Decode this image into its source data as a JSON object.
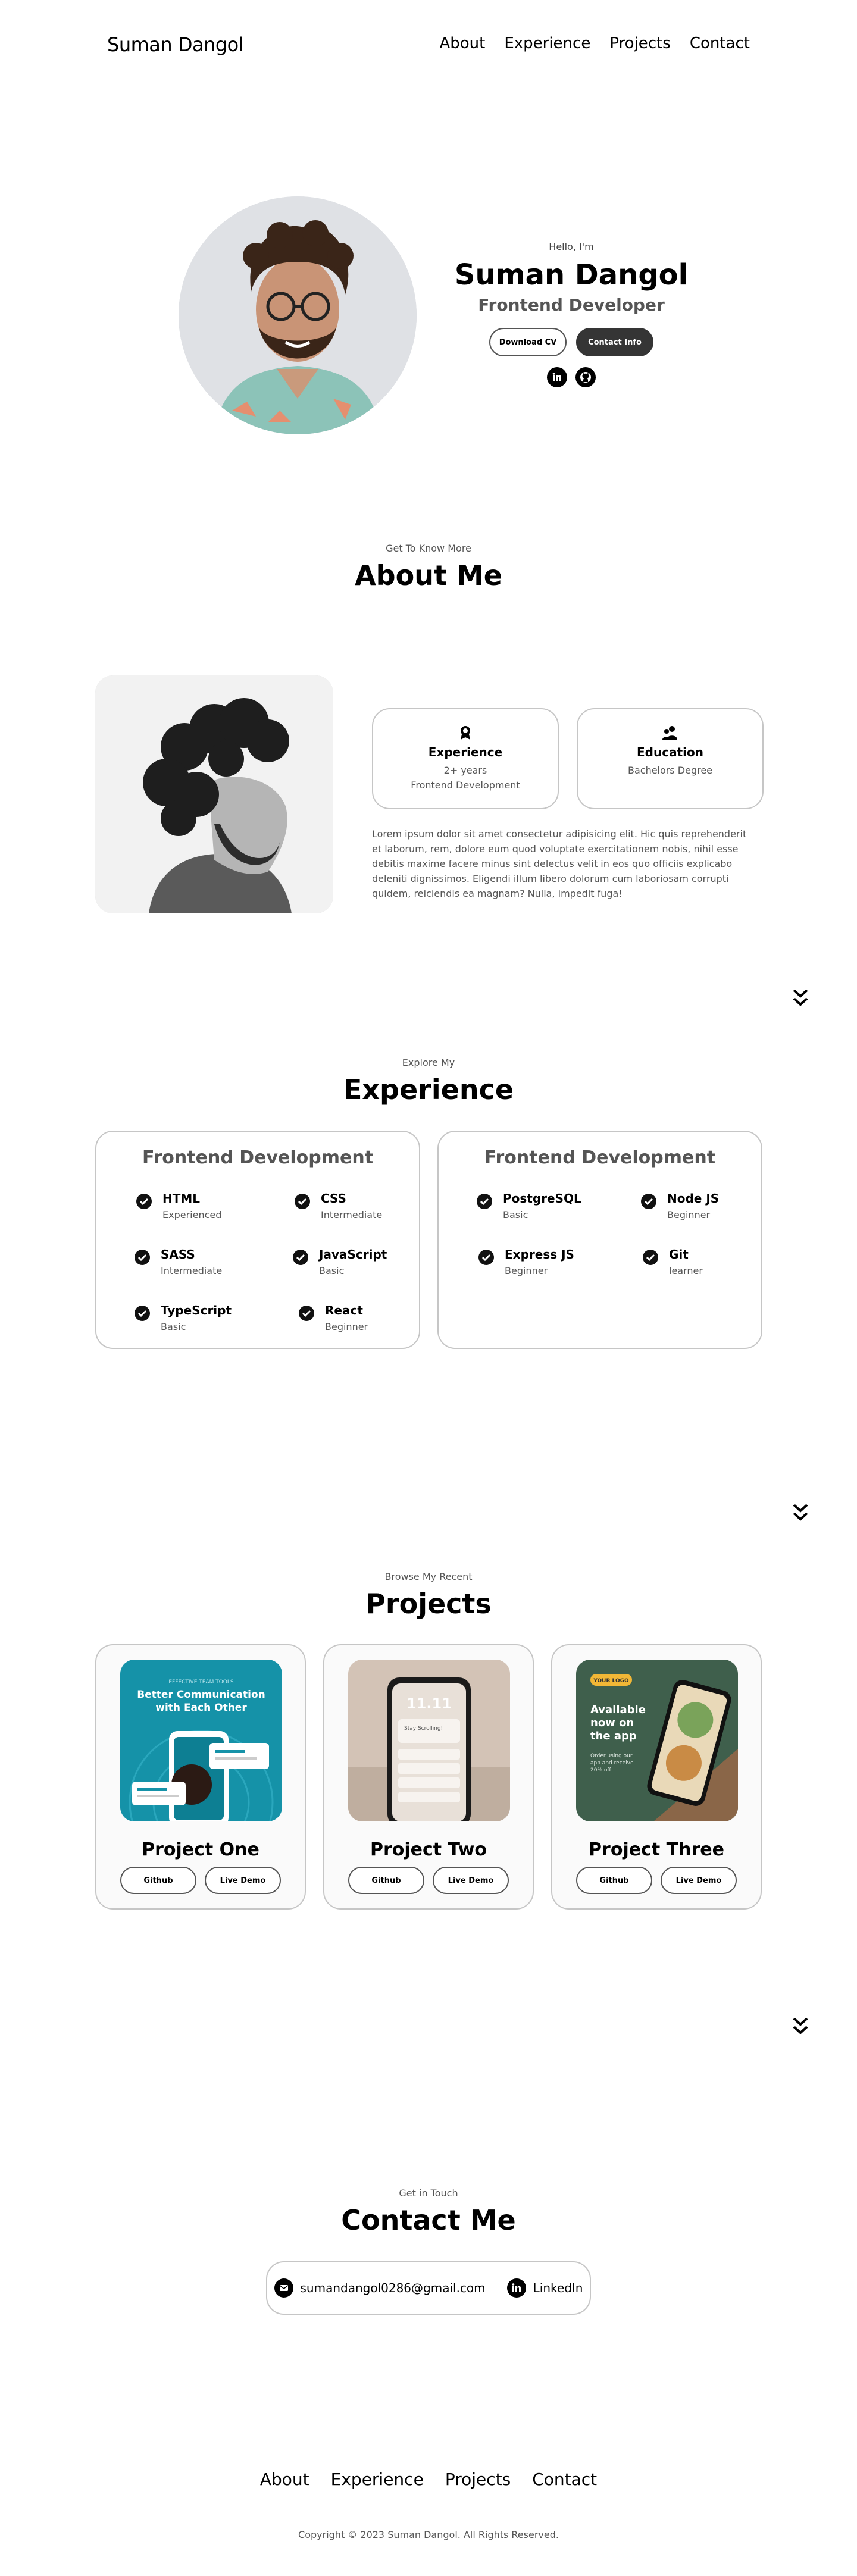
{
  "nav": {
    "logo": "Suman Dangol",
    "links": [
      "About",
      "Experience",
      "Projects",
      "Contact"
    ]
  },
  "hero": {
    "greeting": "Hello, I'm",
    "name": "Suman Dangol",
    "role": "Frontend Developer",
    "download_cv": "Download CV",
    "contact_info": "Contact Info",
    "socials": [
      "linkedin-icon",
      "github-icon"
    ]
  },
  "about": {
    "subtitle": "Get To Know More",
    "title": "About Me",
    "cards": [
      {
        "icon": "medal-icon",
        "title": "Experience",
        "lines": [
          "2+ years",
          "Frontend Development"
        ]
      },
      {
        "icon": "graduation-icon",
        "title": "Education",
        "lines": [
          "Bachelors Degree"
        ]
      }
    ],
    "paragraph": "Lorem ipsum dolor sit amet consectetur adipisicing elit. Hic quis reprehenderit et laborum, rem, dolore eum quod voluptate exercitationem nobis, nihil esse debitis maxime facere minus sint delectus velit in eos quo officiis explicabo deleniti dignissimos. Eligendi illum libero dolorum cum laboriosam corrupti quidem, reiciendis ea magnam? Nulla, impedit fuga!"
  },
  "experience": {
    "subtitle": "Explore My",
    "title": "Experience",
    "cards": [
      {
        "title": "Frontend Development",
        "skills": [
          {
            "name": "HTML",
            "level": "Experienced"
          },
          {
            "name": "CSS",
            "level": "Intermediate"
          },
          {
            "name": "SASS",
            "level": "Intermediate"
          },
          {
            "name": "JavaScript",
            "level": "Basic"
          },
          {
            "name": "TypeScript",
            "level": "Basic"
          },
          {
            "name": "React",
            "level": "Beginner"
          }
        ]
      },
      {
        "title": "Frontend Development",
        "skills": [
          {
            "name": "PostgreSQL",
            "level": "Basic"
          },
          {
            "name": "Node JS",
            "level": "Beginner"
          },
          {
            "name": "Express JS",
            "level": "Beginner"
          },
          {
            "name": "Git",
            "level": "learner"
          }
        ]
      }
    ]
  },
  "projects": {
    "subtitle": "Browse My Recent",
    "title": "Projects",
    "items": [
      {
        "title": "Project One",
        "github": "Github",
        "demo": "Live Demo",
        "img_text": [
          "EFFECTIVE TEAM TOOLS",
          "Better Communication",
          "with Each Other"
        ]
      },
      {
        "title": "Project Two",
        "github": "Github",
        "demo": "Live Demo",
        "img_text": [
          "11.11",
          "Stay Scrolling!"
        ]
      },
      {
        "title": "Project Three",
        "github": "Github",
        "demo": "Live Demo",
        "img_text": [
          "YOUR LOGO",
          "Available",
          "now on",
          "the app",
          "Order using our",
          "app and receive",
          "20% off"
        ]
      }
    ]
  },
  "contact": {
    "subtitle": "Get in Touch",
    "title": "Contact Me",
    "email": "sumandangol0286@gmail.com",
    "linkedin": "LinkedIn"
  },
  "footer": {
    "links": [
      "About",
      "Experience",
      "Projects",
      "Contact"
    ],
    "copyright": "Copyright © 2023 Suman Dangol. All Rights Reserved."
  }
}
